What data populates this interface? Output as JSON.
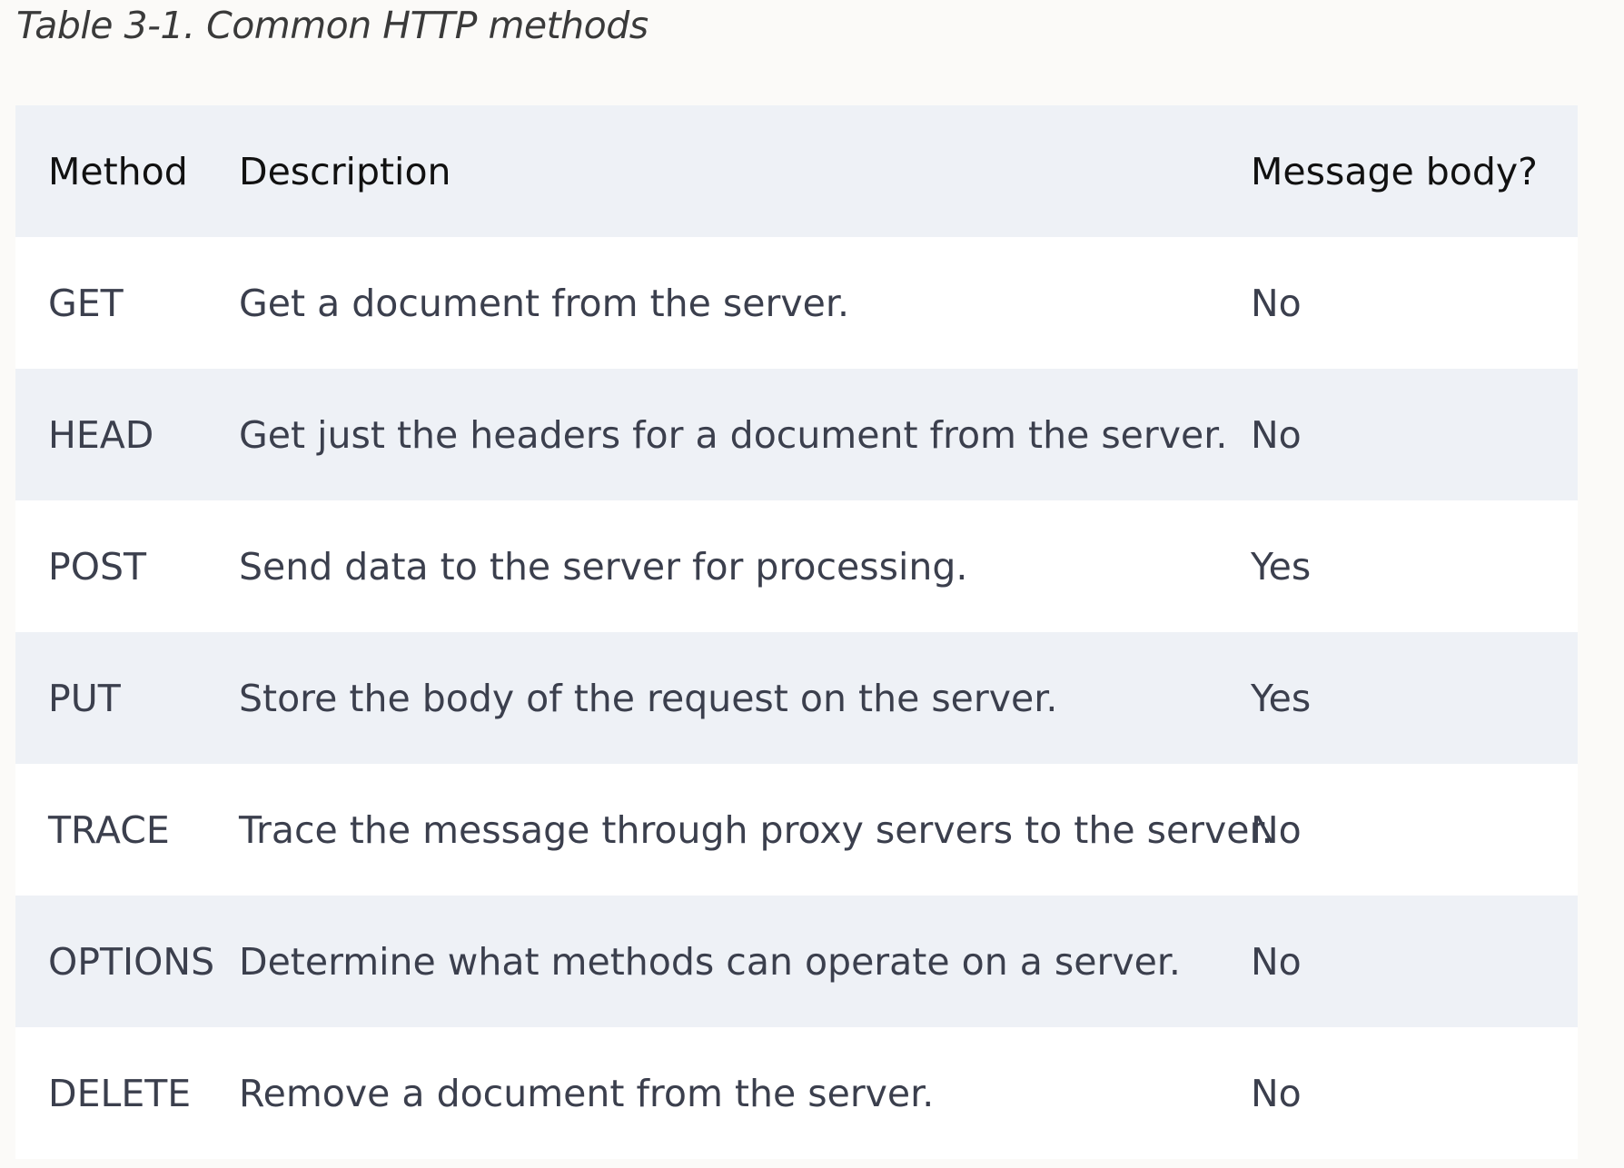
{
  "caption": "Table 3-1. Common HTTP methods",
  "table": {
    "headers": [
      "Method",
      "Description",
      "Message body?"
    ],
    "rows": [
      [
        "GET",
        "Get a document from the server.",
        "No"
      ],
      [
        "HEAD",
        "Get just the headers for a document from the server.",
        "No"
      ],
      [
        "POST",
        "Send data to the server for processing.",
        "Yes"
      ],
      [
        "PUT",
        "Store the body of the request on the server.",
        "Yes"
      ],
      [
        "TRACE",
        "Trace the message through proxy servers to the server.",
        "No"
      ],
      [
        "OPTIONS",
        "Determine what methods can operate on a server.",
        "No"
      ],
      [
        "DELETE",
        "Remove a document from the server.",
        "No"
      ]
    ]
  },
  "colors": {
    "page_background": "#fbfaf8",
    "header_row": "#eef1f6",
    "stripe_row": "#eef1f6",
    "plain_row": "#ffffff",
    "text": "#3b3f4d"
  }
}
